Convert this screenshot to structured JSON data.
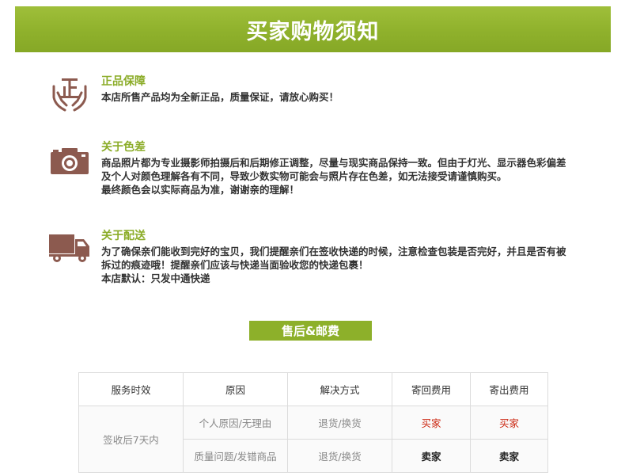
{
  "banner": {
    "title": "买家购物须知"
  },
  "sections": [
    {
      "title": "正品保障",
      "icon": "hands-zheng-icon",
      "lines": [
        "本店所售产品均为全新正品，质量保证，请放心购买！"
      ]
    },
    {
      "title": "关于色差",
      "icon": "camera-icon",
      "lines": [
        "商品照片都为专业摄影师拍摄后和后期修正调整，尽量与现实商品保持一致。但由于灯光、显示器色彩偏差",
        "及个人对颜色理解各有不同，导致少数实物可能会与照片存在色差，如无法接受请谨慎购买。",
        "最终颜色会以实际商品为准，谢谢亲的理解！"
      ]
    },
    {
      "title": "关于配送",
      "icon": "truck-icon",
      "lines": [
        "为了确保亲们能收到完好的宝贝，我们提醒亲们在签收快递的时候，注意检查包装是否完好，并且是否有被",
        "拆过的痕迹哦！提醒亲们应该与快递当面验收您的快递包裹！",
        "本店默认：只发中通快递"
      ]
    }
  ],
  "after_sale": {
    "title": "售后&邮费",
    "headers": [
      "服务时效",
      "原因",
      "解决方式",
      "寄回费用",
      "寄出费用"
    ],
    "period": "签收后7天内",
    "rows": [
      {
        "reason": "个人原因/无理由",
        "solution": "退货/换货",
        "return_fee": "买家",
        "send_fee": "买家"
      },
      {
        "reason": "质量问题/发错商品",
        "solution": "退货/换货",
        "return_fee": "卖家",
        "send_fee": "卖家"
      }
    ]
  },
  "colors": {
    "accent": "#8db02a",
    "icon": "#8c5a4f",
    "fee_red": "#cc2a14"
  }
}
